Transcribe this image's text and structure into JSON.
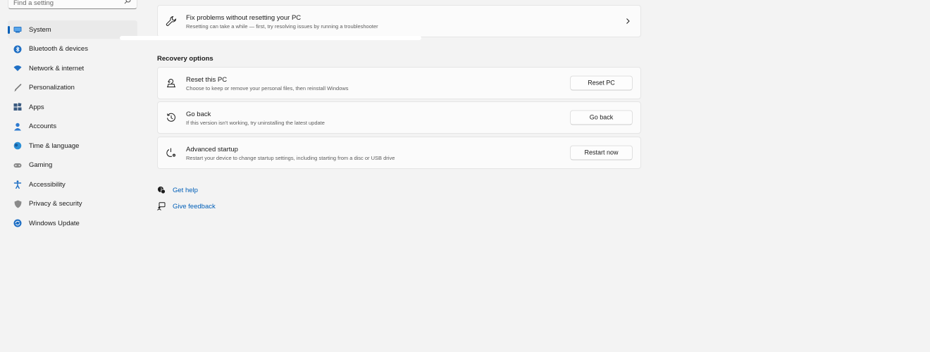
{
  "search": {
    "placeholder": "Find a setting",
    "icon": "search-icon"
  },
  "sidebar": {
    "items": [
      {
        "label": "System",
        "icon": "system-icon",
        "active": true
      },
      {
        "label": "Bluetooth & devices",
        "icon": "bluetooth-icon"
      },
      {
        "label": "Network & internet",
        "icon": "wifi-icon"
      },
      {
        "label": "Personalization",
        "icon": "brush-icon"
      },
      {
        "label": "Apps",
        "icon": "apps-icon"
      },
      {
        "label": "Accounts",
        "icon": "account-icon"
      },
      {
        "label": "Time & language",
        "icon": "globe-clock-icon"
      },
      {
        "label": "Gaming",
        "icon": "gamepad-icon"
      },
      {
        "label": "Accessibility",
        "icon": "accessibility-icon"
      },
      {
        "label": "Privacy & security",
        "icon": "shield-icon"
      },
      {
        "label": "Windows Update",
        "icon": "update-icon"
      }
    ]
  },
  "fix_card": {
    "title": "Fix problems without resetting your PC",
    "subtitle": "Resetting can take a while — first, try resolving issues by running a troubleshooter",
    "icon": "wrench-icon"
  },
  "recovery": {
    "section_title": "Recovery options",
    "options": [
      {
        "title": "Reset this PC",
        "subtitle": "Choose to keep or remove your personal files, then reinstall Windows",
        "button": "Reset PC",
        "icon": "reset-pc-icon"
      },
      {
        "title": "Go back",
        "subtitle": "If this version isn't working, try uninstalling the latest update",
        "button": "Go back",
        "icon": "history-icon"
      },
      {
        "title": "Advanced startup",
        "subtitle": "Restart your device to change startup settings, including starting from a disc or USB drive",
        "button": "Restart now",
        "icon": "advanced-startup-icon"
      }
    ]
  },
  "help": {
    "get_help": "Get help",
    "give_feedback": "Give feedback"
  },
  "colors": {
    "accent": "#005fb8",
    "background": "#f3f3f3",
    "card": "#fbfbfb"
  }
}
